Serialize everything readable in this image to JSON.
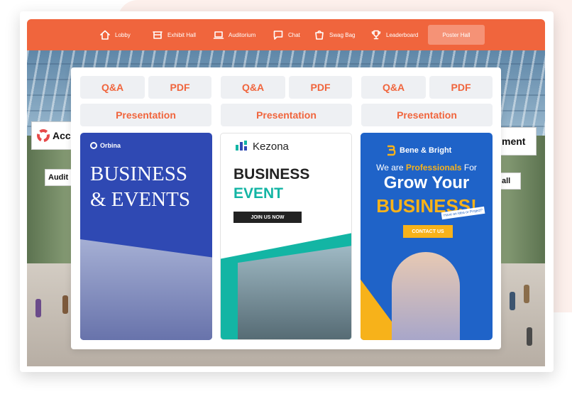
{
  "nav": {
    "items": [
      {
        "label": "Lobby",
        "icon": "home-icon"
      },
      {
        "label": "Exhibit Hall",
        "icon": "booth-icon"
      },
      {
        "label": "Auditorium",
        "icon": "monitor-icon"
      },
      {
        "label": "Chat",
        "icon": "chat-icon"
      },
      {
        "label": "Swag Bag",
        "icon": "bag-icon"
      },
      {
        "label": "Leaderboard",
        "icon": "trophy-icon"
      }
    ],
    "active": "Poster Hall",
    "colors": {
      "bar": "#f0653d",
      "active": "#f59276"
    }
  },
  "background": {
    "sign_left": "Acc",
    "sign_left_sub": "Audit",
    "sign_right": "ment",
    "sign_right_sub": "all"
  },
  "posters": [
    {
      "buttons": {
        "qa": "Q&A",
        "pdf": "PDF",
        "presentation": "Presentation"
      },
      "brand": "Orbina",
      "title_line1": "BUSINESS",
      "title_line2": "& EVENTS"
    },
    {
      "buttons": {
        "qa": "Q&A",
        "pdf": "PDF",
        "presentation": "Presentation"
      },
      "brand": "Kezona",
      "title_line1": "BUSINESS",
      "title_line2": "EVENT",
      "cta": "JOIN US NOW"
    },
    {
      "buttons": {
        "qa": "Q&A",
        "pdf": "PDF",
        "presentation": "Presentation"
      },
      "brand": "Bene & Bright",
      "line1_pre": "We are ",
      "line1_highlight": "Professionals",
      "line1_post": " For",
      "line2": "Grow Your",
      "line3": "BUSINESS!",
      "tag": "Have an Idea or Project?",
      "cta": "CONTACT US"
    }
  ],
  "accent": "#f0653d"
}
